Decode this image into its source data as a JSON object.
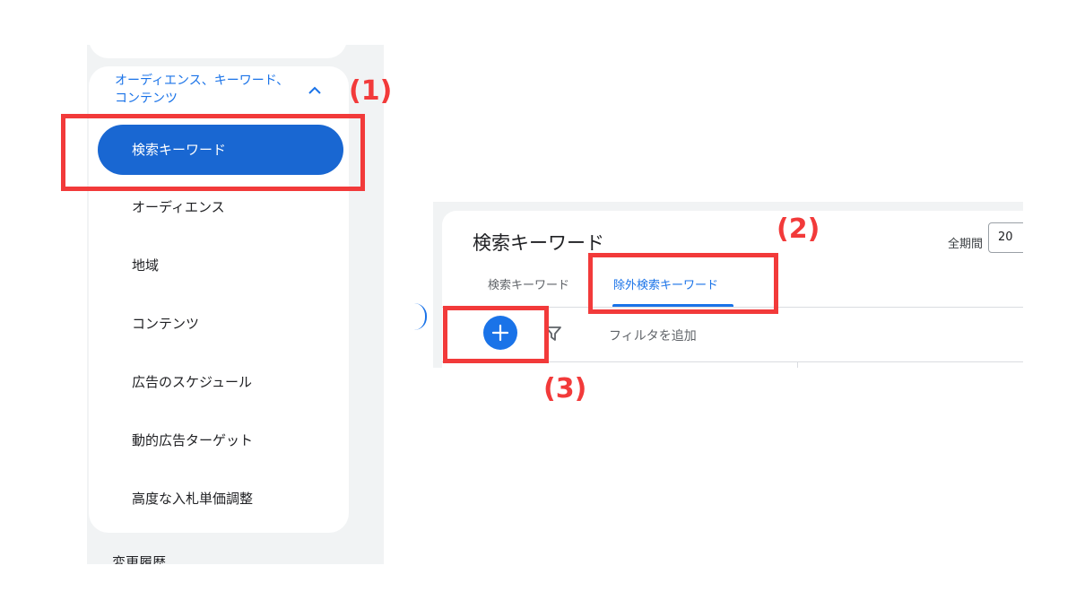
{
  "sidebar": {
    "section_header": "オーディエンス、キーワード、コンテンツ",
    "items": [
      {
        "label": "検索キーワード",
        "active": true
      },
      {
        "label": "オーディエンス",
        "active": false
      },
      {
        "label": "地域",
        "active": false
      },
      {
        "label": "コンテンツ",
        "active": false
      },
      {
        "label": "広告のスケジュール",
        "active": false
      },
      {
        "label": "動的広告ターゲット",
        "active": false
      },
      {
        "label": "高度な入札単価調整",
        "active": false
      }
    ],
    "bottom_item": "変更履歴"
  },
  "content": {
    "page_title": "検索キーワード",
    "date_range_label": "全期間",
    "date_value": "20",
    "tabs": [
      {
        "label": "検索キーワード",
        "active": false
      },
      {
        "label": "除外検索キーワード",
        "active": true
      }
    ],
    "filter_placeholder": "フィルタを追加"
  },
  "annotations": {
    "step1": "(1)",
    "step2": "(2)",
    "step3": "(3)"
  },
  "colors": {
    "accent": "#1a73e8",
    "active_pill": "#1967d2",
    "highlight": "#f23a3a",
    "panel_bg": "#f1f3f4"
  },
  "icons": {
    "chevron": "chevron-up-icon",
    "add": "plus-icon",
    "filter": "filter-funnel-icon"
  }
}
